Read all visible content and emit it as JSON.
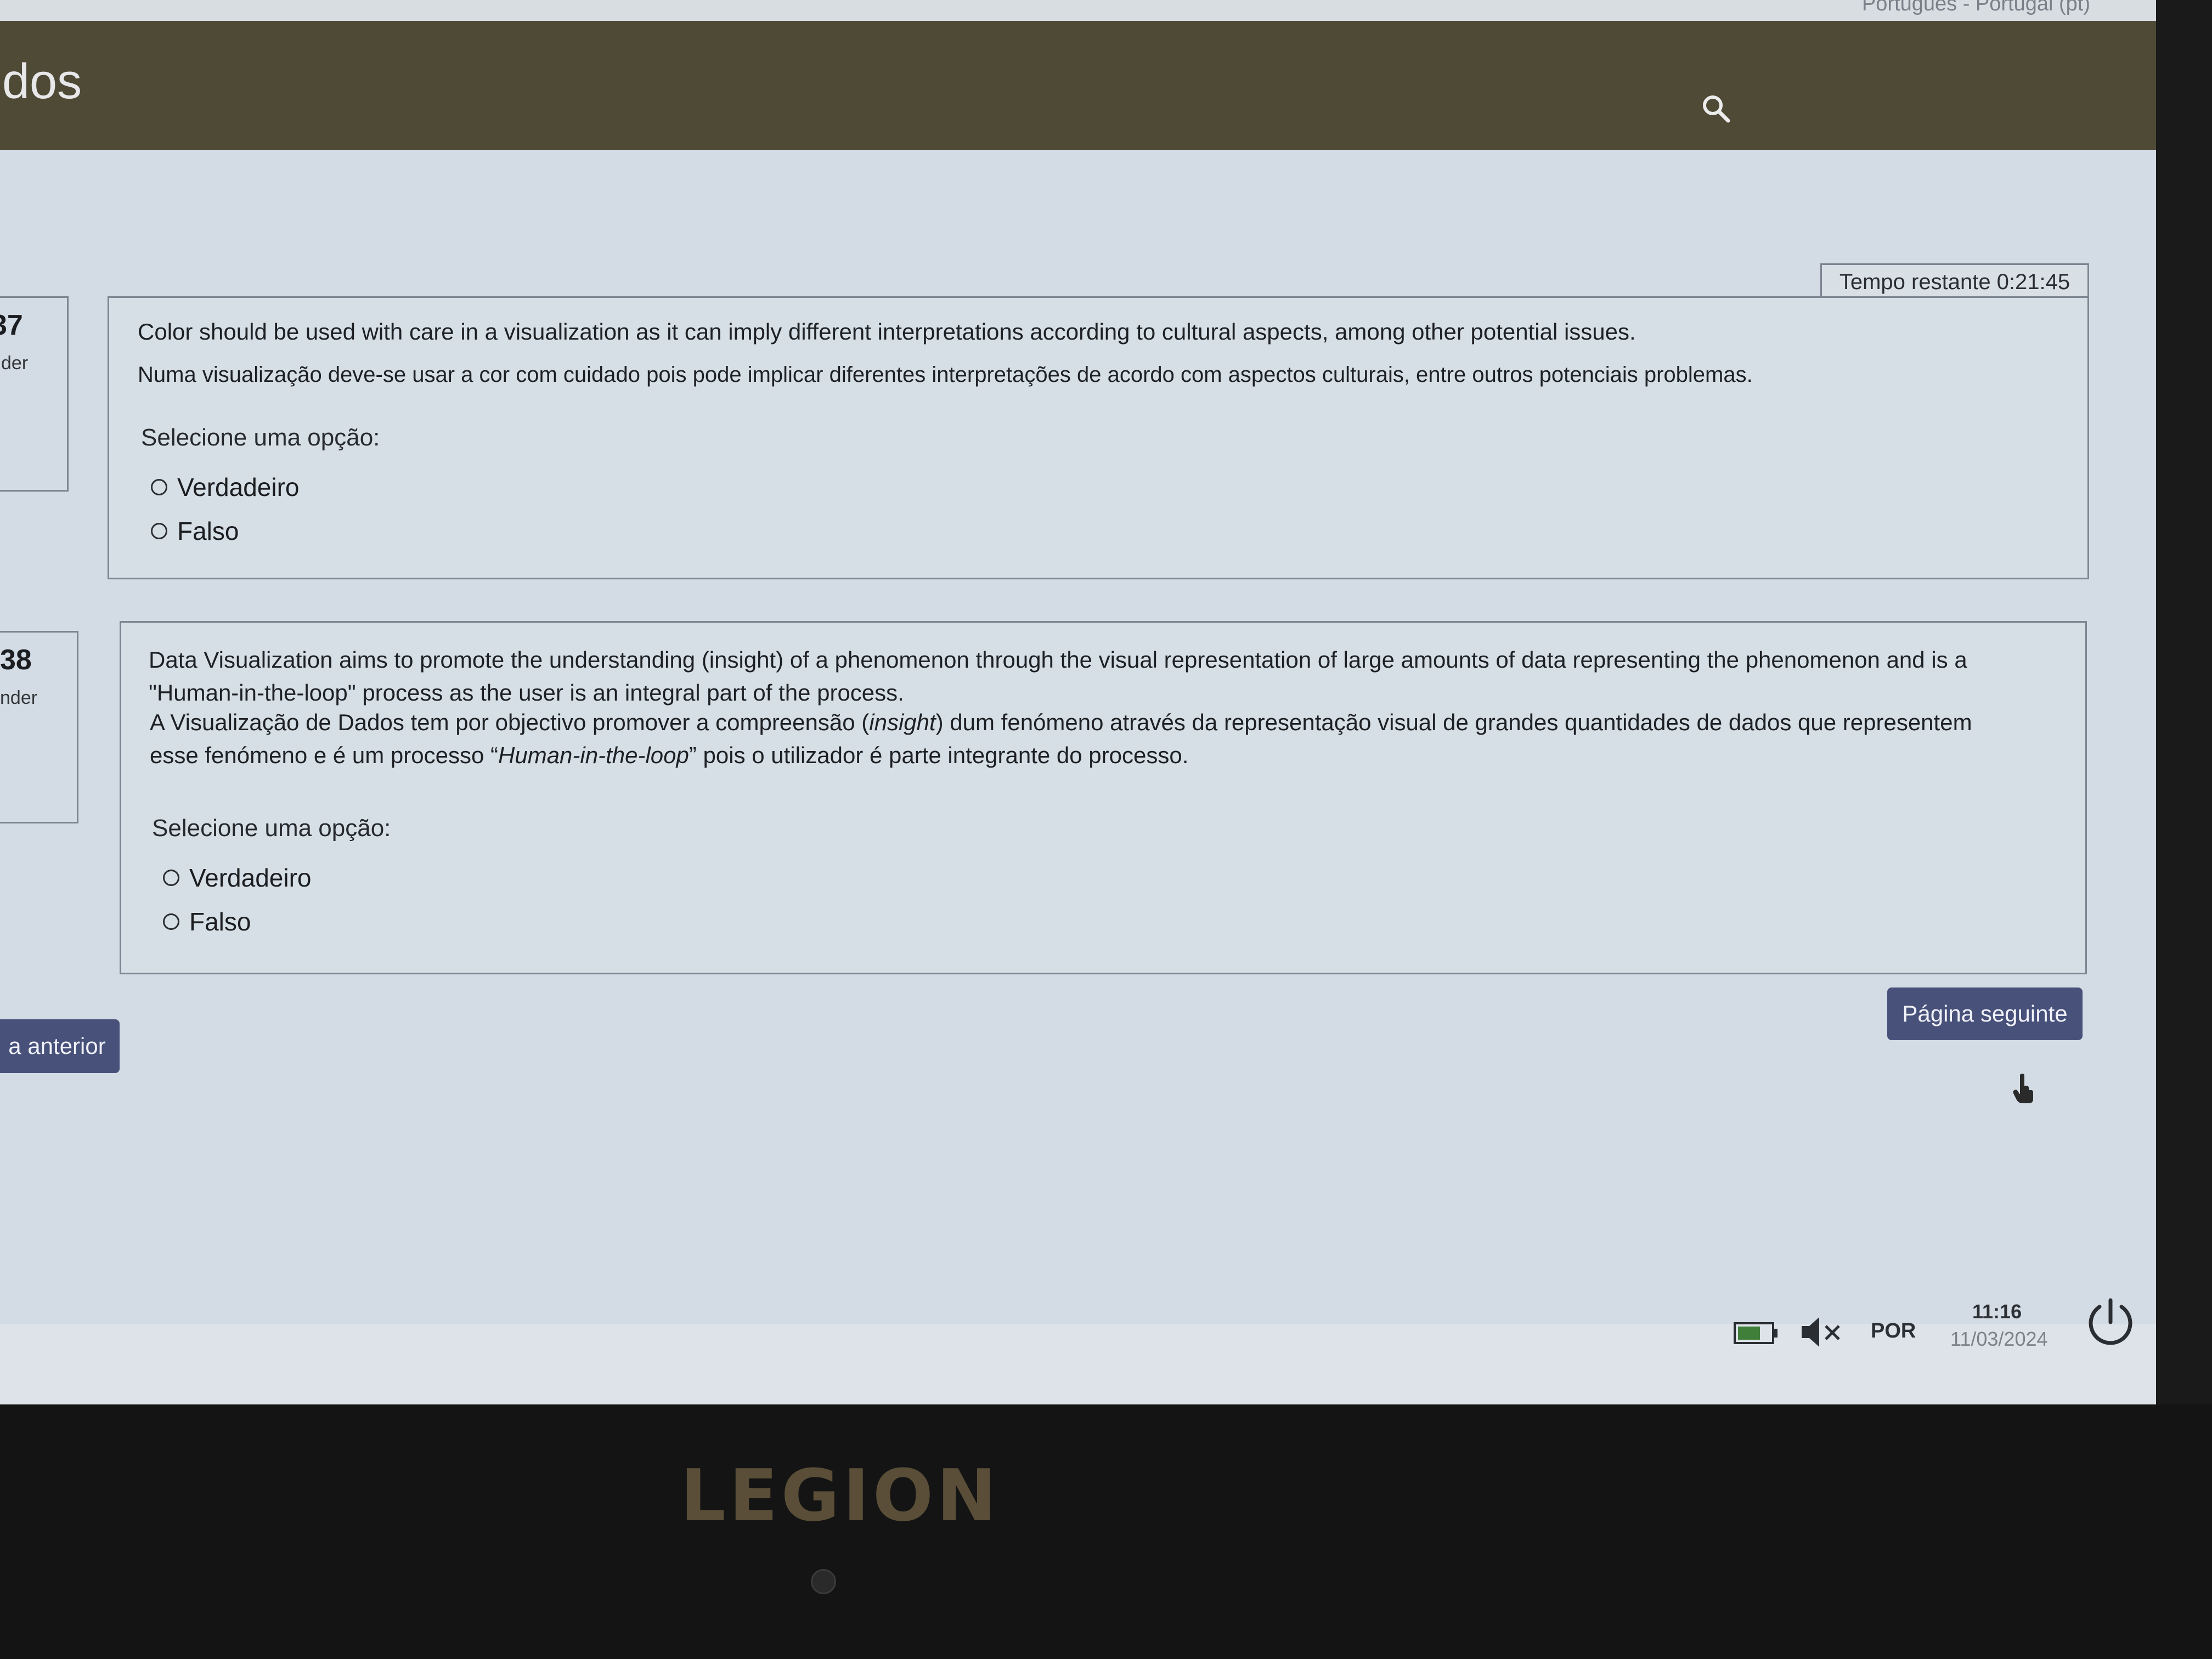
{
  "header": {
    "title": "dos",
    "language_selector": "Português - Portugal (pt)"
  },
  "timer": {
    "label": "Tempo restante 0:21:45"
  },
  "questions": [
    {
      "number": "37",
      "status": "der",
      "text_en": "Color should be used with care in a visualization as it can imply different interpretations according to cultural aspects, among other potential issues.",
      "text_pt": "Numa visualização deve-se usar a cor com cuidado pois pode implicar diferentes interpretações de acordo com aspectos culturais, entre outros potenciais problemas.",
      "prompt": "Selecione uma opção:",
      "options": [
        "Verdadeiro",
        "Falso"
      ]
    },
    {
      "number": "38",
      "status": "nder",
      "text_en_1": "Data Visualization aims to promote the understanding (insight) of a phenomenon through the visual representation of large amounts of data representing the phenomenon and is a",
      "text_en_2": "\"Human-in-the-loop\" process as the user is an integral part of the process.",
      "text_pt_1a": "A Visualização de Dados tem por objectivo promover a compreensão (",
      "text_pt_1b": "insight",
      "text_pt_1c": ") dum fenómeno através da representação visual de grandes quantidades de dados que representem",
      "text_pt_2a": "esse fenómeno e é um processo “",
      "text_pt_2b": "Human-in-the-loop",
      "text_pt_2c": "” pois o utilizador é parte integrante do processo.",
      "prompt": "Selecione uma opção:",
      "options": [
        "Verdadeiro",
        "Falso"
      ]
    }
  ],
  "nav": {
    "previous_label": "a anterior",
    "next_label": "Página seguinte"
  },
  "taskbar": {
    "language": "POR",
    "time": "11:16",
    "date": "11/03/2024"
  },
  "bezel": {
    "brand": "LEGION"
  },
  "colors": {
    "header": "#4e4a36",
    "button": "#48517a",
    "background": "#d3dce4"
  }
}
